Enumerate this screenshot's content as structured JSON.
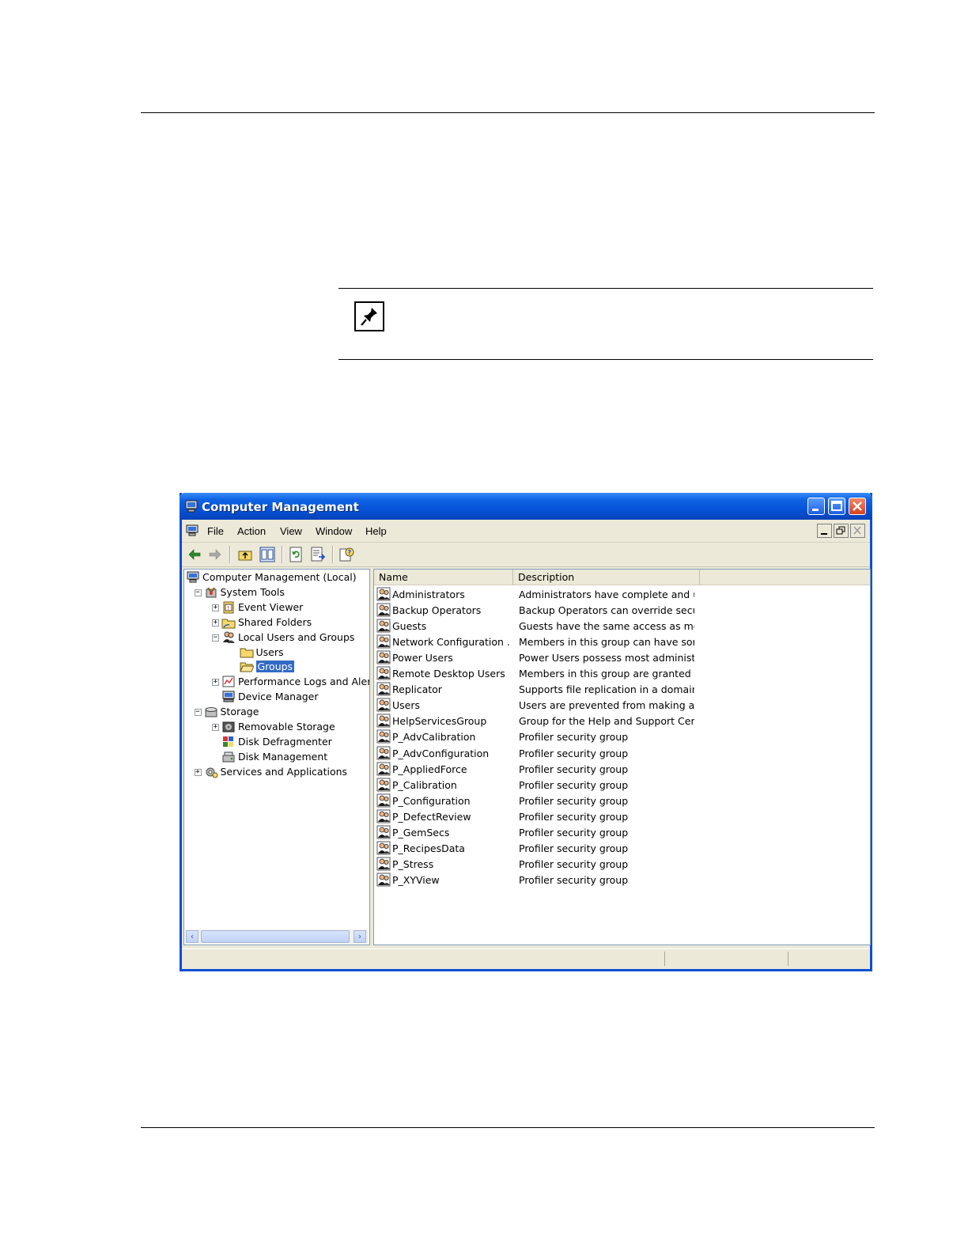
{
  "window": {
    "title": "Computer Management",
    "menu": [
      "File",
      "Action",
      "View",
      "Window",
      "Help"
    ]
  },
  "tree": [
    {
      "label": "Computer Management (Local)",
      "icon": "computer-icon",
      "expander": ""
    },
    {
      "label": "System Tools",
      "icon": "tools-icon",
      "expander": "−"
    },
    {
      "label": "Event Viewer",
      "icon": "event-viewer-icon",
      "expander": "+"
    },
    {
      "label": "Shared Folders",
      "icon": "folder-share-icon",
      "expander": "+"
    },
    {
      "label": "Local Users and Groups",
      "icon": "users-groups-icon",
      "expander": "−"
    },
    {
      "label": "Users",
      "icon": "folder-icon",
      "expander": ""
    },
    {
      "label": "Groups",
      "icon": "folder-open-icon",
      "expander": "",
      "selected": true
    },
    {
      "label": "Performance Logs and Alerts",
      "icon": "performance-icon",
      "expander": "+"
    },
    {
      "label": "Device Manager",
      "icon": "device-manager-icon",
      "expander": ""
    },
    {
      "label": "Storage",
      "icon": "storage-icon",
      "expander": "−"
    },
    {
      "label": "Removable Storage",
      "icon": "removable-storage-icon",
      "expander": "+"
    },
    {
      "label": "Disk Defragmenter",
      "icon": "defragmenter-icon",
      "expander": ""
    },
    {
      "label": "Disk Management",
      "icon": "disk-management-icon",
      "expander": ""
    },
    {
      "label": "Services and Applications",
      "icon": "services-icon",
      "expander": "+"
    }
  ],
  "list": {
    "columns": [
      "Name",
      "Description"
    ],
    "rows": [
      {
        "name": "Administrators",
        "description": "Administrators have complete and u..."
      },
      {
        "name": "Backup Operators",
        "description": "Backup Operators can override secu..."
      },
      {
        "name": "Guests",
        "description": "Guests have the same access as me..."
      },
      {
        "name": "Network Configuration ...",
        "description": "Members in this group can have som..."
      },
      {
        "name": "Power Users",
        "description": "Power Users possess most administr..."
      },
      {
        "name": "Remote Desktop Users",
        "description": "Members in this group are granted t..."
      },
      {
        "name": "Replicator",
        "description": "Supports file replication in a domain"
      },
      {
        "name": "Users",
        "description": "Users are prevented from making ac..."
      },
      {
        "name": "HelpServicesGroup",
        "description": "Group for the Help and Support Center"
      },
      {
        "name": "P_AdvCalibration",
        "description": "Profiler security group"
      },
      {
        "name": "P_AdvConfiguration",
        "description": "Profiler security group"
      },
      {
        "name": "P_AppliedForce",
        "description": "Profiler security group"
      },
      {
        "name": "P_Calibration",
        "description": "Profiler security group"
      },
      {
        "name": "P_Configuration",
        "description": "Profiler security group"
      },
      {
        "name": "P_DefectReview",
        "description": "Profiler security group"
      },
      {
        "name": "P_GemSecs",
        "description": "Profiler security group"
      },
      {
        "name": "P_RecipesData",
        "description": "Profiler security group"
      },
      {
        "name": "P_Stress",
        "description": "Profiler security group"
      },
      {
        "name": "P_XYView",
        "description": "Profiler security group"
      }
    ]
  },
  "icons": {
    "note": "pushpin-icon",
    "group": "group-icon"
  },
  "colors": {
    "titlebar": "#0553d8",
    "selection": "#316ac5",
    "window_border": "#0b4fd6"
  }
}
